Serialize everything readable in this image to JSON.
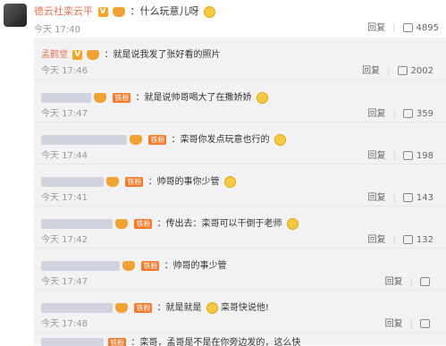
{
  "main_comment": {
    "username": "德云社栾云平",
    "text": "：什么玩意儿呀",
    "time": "今天 17:40",
    "reply_label": "回复",
    "likes": "4895"
  },
  "replies": [
    {
      "username": "孟鹤堂",
      "text": "：就是说我发了张好看的照片",
      "time": "今天 17:46",
      "reply_label": "回复",
      "likes": "2002",
      "has_fan_badge": false
    },
    {
      "username": "",
      "text": "：就是说帅哥喝大了在撒娇娇",
      "time": "今天 17:47",
      "reply_label": "回复",
      "likes": "359",
      "has_fan_badge": true
    },
    {
      "username": "",
      "text": "：栾哥你发点玩意也行的",
      "time": "今天 17:44",
      "reply_label": "回复",
      "likes": "198",
      "has_fan_badge": true
    },
    {
      "username": "",
      "text": "：帅哥的事你少管",
      "time": "今天 17:41",
      "reply_label": "回复",
      "likes": "143",
      "has_fan_badge": true
    },
    {
      "username": "",
      "text": "：传出去：栾哥可以干倒于老师",
      "time": "今天 17:42",
      "reply_label": "回复",
      "likes": "132",
      "has_fan_badge": true
    },
    {
      "username": "",
      "text": "：帅哥的事少管",
      "time": "今天 17:47",
      "reply_label": "回复",
      "likes": "",
      "has_fan_badge": true
    },
    {
      "username": "",
      "text": "：就是就是",
      "text2": "栾哥快说他!",
      "time": "今天 17:48",
      "reply_label": "回复",
      "likes": "",
      "has_fan_badge": true
    },
    {
      "username": "",
      "text": "：栾哥，孟哥是不是在你旁边发的，这么快",
      "time": "",
      "reply_label": "",
      "likes": "",
      "has_fan_badge": true
    }
  ],
  "fan_badge_label": "铁粉",
  "verified_badge": "V",
  "colors": {
    "username": "#eb7350",
    "thread_bg": "#f2f2f5",
    "fan_badge": "#f77a2a"
  }
}
